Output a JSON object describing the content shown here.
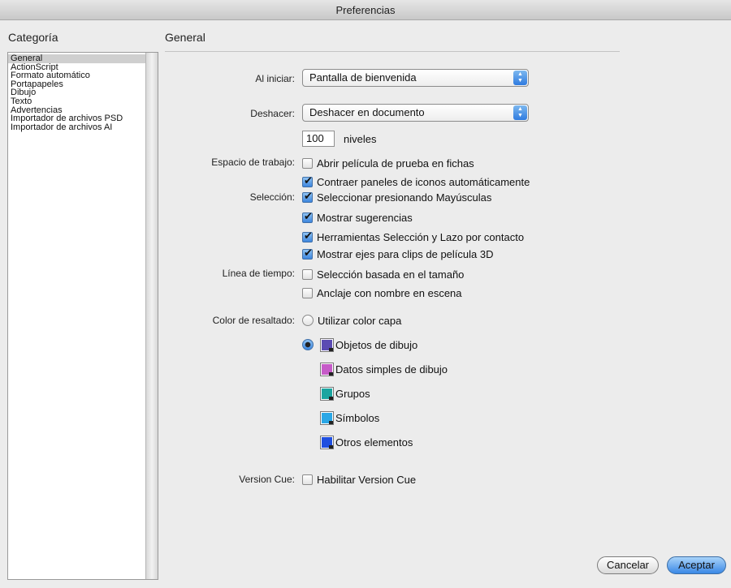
{
  "window": {
    "title": "Preferencias"
  },
  "sidebar": {
    "heading": "Categoría",
    "items": [
      {
        "label": "General",
        "selected": true
      },
      {
        "label": "ActionScript"
      },
      {
        "label": "Formato automático"
      },
      {
        "label": "Portapapeles"
      },
      {
        "label": "Dibujo"
      },
      {
        "label": "Texto"
      },
      {
        "label": "Advertencias"
      },
      {
        "label": "Importador de archivos PSD"
      },
      {
        "label": "Importador de archivos AI"
      }
    ]
  },
  "main": {
    "heading": "General",
    "on_start": {
      "label": "Al iniciar:",
      "value": "Pantalla de bienvenida"
    },
    "undo": {
      "label": "Deshacer:",
      "value": "Deshacer en documento",
      "levels": "100",
      "levels_label": "niveles"
    },
    "workspace": {
      "label": "Espacio de trabajo:",
      "options": [
        {
          "label": "Abrir película de prueba en fichas",
          "checked": false
        },
        {
          "label": "Contraer paneles de iconos automáticamente",
          "checked": true
        }
      ]
    },
    "selection": {
      "label": "Selección:",
      "options": [
        {
          "label": "Seleccionar presionando Mayúsculas",
          "checked": true
        },
        {
          "label": "Mostrar sugerencias",
          "checked": true
        },
        {
          "label": "Herramientas Selección y Lazo por contacto",
          "checked": true
        },
        {
          "label": "Mostrar ejes para clips de película 3D",
          "checked": true
        }
      ]
    },
    "timeline": {
      "label": "Línea de tiempo:",
      "options": [
        {
          "label": "Selección basada en el tamaño",
          "checked": false
        },
        {
          "label": "Anclaje con nombre en escena",
          "checked": false
        }
      ]
    },
    "highlight": {
      "label": "Color de resaltado:",
      "layer_color": {
        "label": "Utilizar color capa",
        "selected": false
      },
      "custom": {
        "selected": true
      },
      "swatches": [
        {
          "label": "Objetos de dibujo",
          "color": "#5b4bb3"
        },
        {
          "label": "Datos simples de dibujo",
          "color": "#c65bc8"
        },
        {
          "label": "Grupos",
          "color": "#1ba5a0"
        },
        {
          "label": "Símbolos",
          "color": "#2aa7e6"
        },
        {
          "label": "Otros elementos",
          "color": "#1f4fe0"
        }
      ]
    },
    "version_cue": {
      "label": "Version Cue:",
      "option": "Habilitar Version Cue",
      "checked": false
    }
  },
  "buttons": {
    "cancel": "Cancelar",
    "accept": "Aceptar"
  }
}
